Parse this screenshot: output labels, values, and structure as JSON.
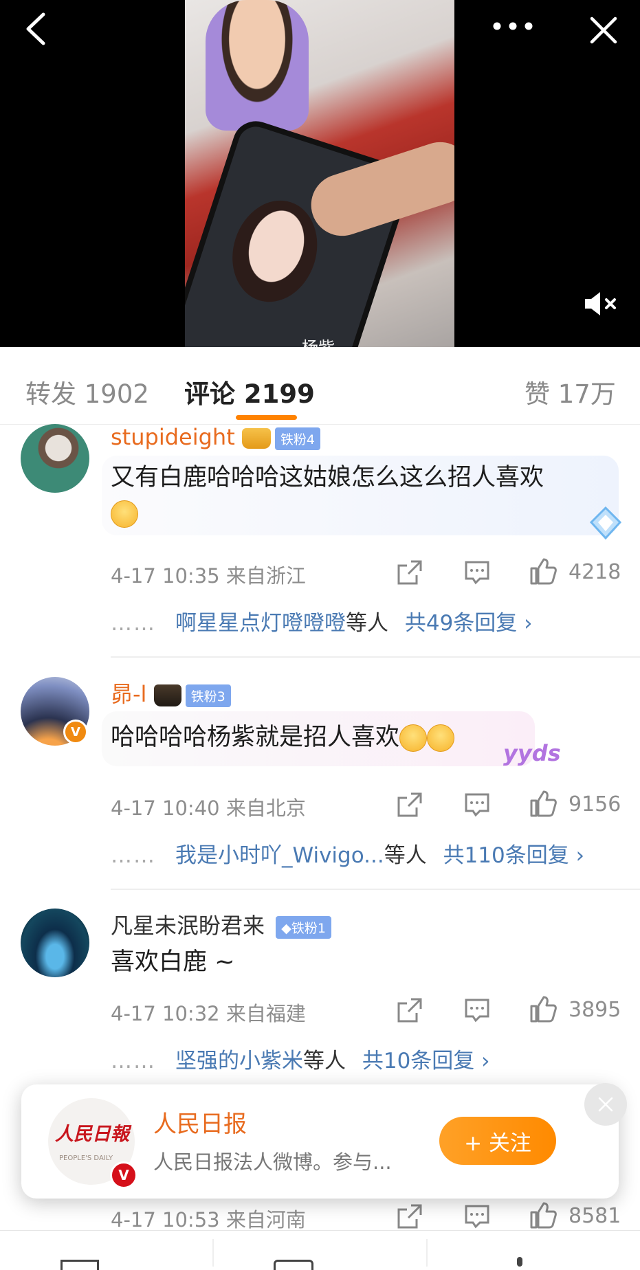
{
  "video": {
    "caption": "杨紫",
    "mute_icon": "volume-mute-icon"
  },
  "tabs": [
    {
      "label": "转发",
      "count": "1902"
    },
    {
      "label": "评论",
      "count": "2199"
    },
    {
      "label": "赞",
      "count": "17万"
    }
  ],
  "comments": [
    {
      "username": "stupideight",
      "fan_badge": "铁粉4",
      "text_line1": "又有白鹿哈哈哈这姑娘怎么这么招人喜欢",
      "time": "4-17 10:35",
      "location": "来自浙江",
      "likes": "4218",
      "reply_user": "啊星星点灯噔噔噔",
      "reply_mid": "等人",
      "reply_total": "共49条回复"
    },
    {
      "username": "昴-l",
      "fan_badge": "铁粉3",
      "text_line1": "哈哈哈哈杨紫就是招人喜欢",
      "sticker_text": "yyds",
      "time": "4-17 10:40",
      "location": "来自北京",
      "likes": "9156",
      "reply_user": "我是小时吖_Wivigo...",
      "reply_mid": "等人",
      "reply_total": "共110条回复"
    },
    {
      "username": "凡星未泯盼君来",
      "fan_badge": "铁粉1",
      "text_line1": "喜欢白鹿 ~",
      "time": "4-17 10:32",
      "location": "来自福建",
      "likes": "3895",
      "reply_user": "坚强的小紫米",
      "reply_mid": "等人",
      "reply_total": "共10条回复"
    },
    {
      "time": "4-17 10:53",
      "location": "来自河南",
      "likes": "8581"
    }
  ],
  "popup": {
    "logo_text": "人民日報",
    "logo_sub": "PEOPLE'S DAILY",
    "verified": "V",
    "title": "人民日报",
    "description": "人民日报法人微博。参与...",
    "follow_label": "+ 关注"
  },
  "colors": {
    "accent": "#ff8200",
    "link": "#4a7ab3",
    "username_orange": "#e86b1f"
  }
}
